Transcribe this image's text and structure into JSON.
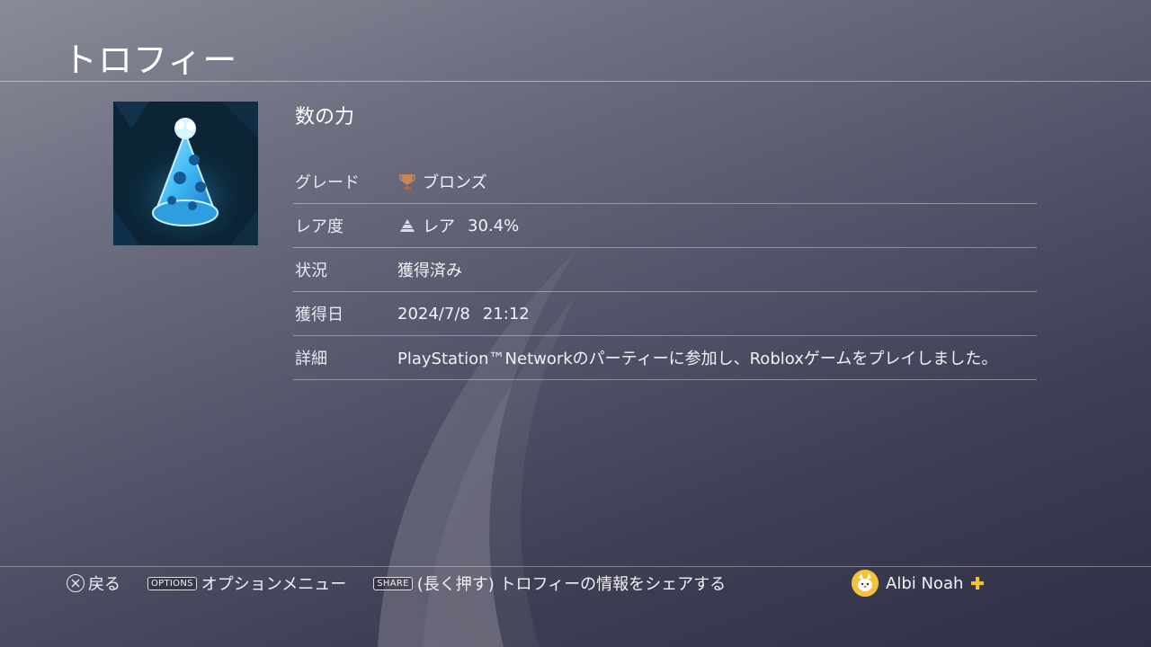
{
  "header": {
    "title": "トロフィー"
  },
  "trophy": {
    "name": "数の力",
    "image_icon": "party-hat-icon",
    "details": [
      {
        "label": "グレード",
        "value": "ブロンズ",
        "icon": "bronze-trophy-icon"
      },
      {
        "label": "レア度",
        "value": "レア",
        "extra": "30.4%",
        "icon": "rarity-pyramid-icon"
      },
      {
        "label": "状況",
        "value": "獲得済み"
      },
      {
        "label": "獲得日",
        "value": "2024/7/8",
        "extra": "21:12"
      },
      {
        "label": "詳細",
        "value": "PlayStation™Networkのパーティーに参加し、Robloxゲームをプレイしました。"
      }
    ]
  },
  "footer": {
    "back": {
      "icon": "cross-button-icon",
      "label": "戻る"
    },
    "options": {
      "key": "OPTIONS",
      "label": "オプションメニュー"
    },
    "share": {
      "key": "SHARE",
      "label": "(長く押す) トロフィーの情報をシェアする"
    }
  },
  "user": {
    "name": "Albi Noah",
    "badge_icon": "ps-plus-icon"
  },
  "colors": {
    "bronze": "#c8845a",
    "hat_blue": "#3fb8f5",
    "plus": "#f5c518"
  }
}
